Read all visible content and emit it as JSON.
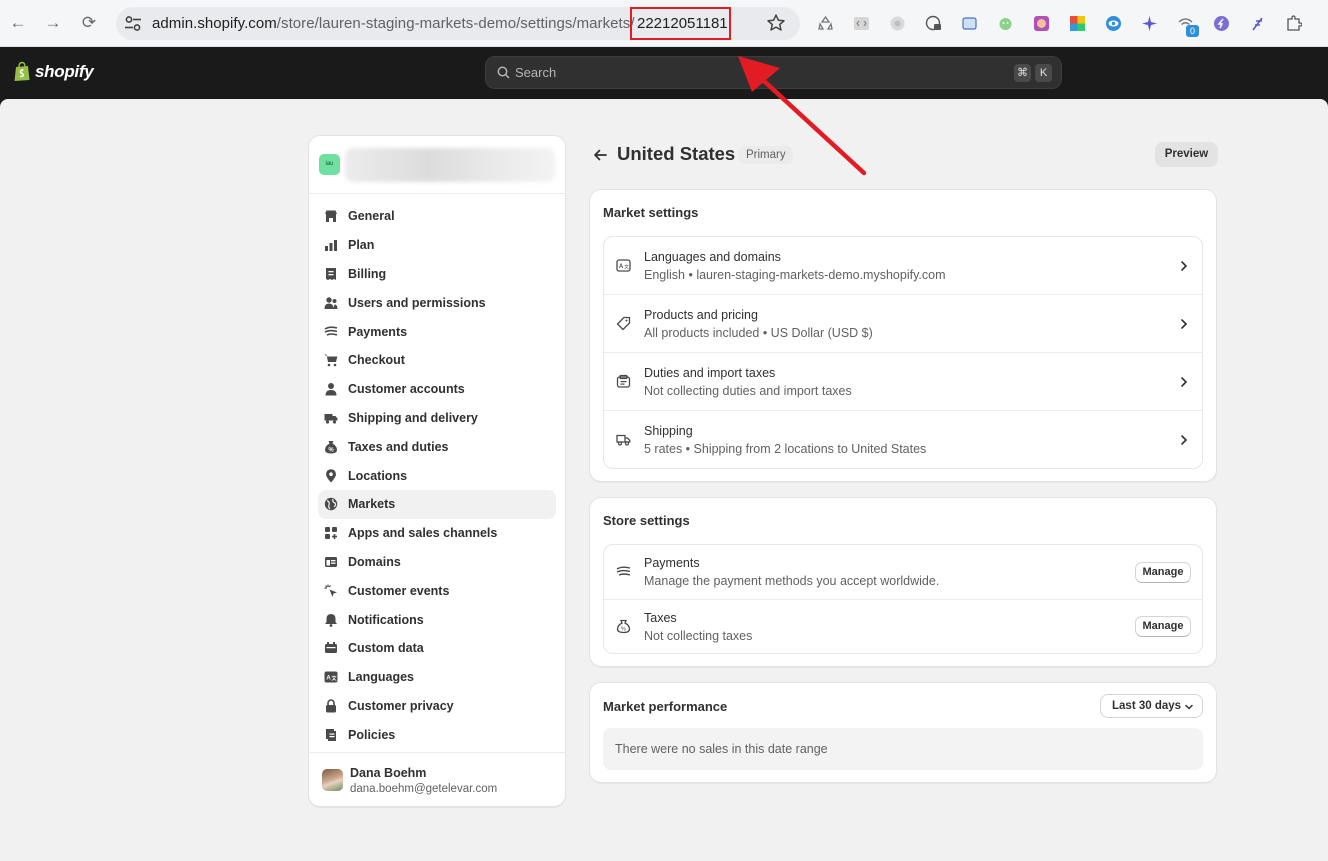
{
  "browser": {
    "url_host": "admin.shopify.com",
    "url_path": "/store/lauren-staging-markets-demo/settings/markets/",
    "url_id": "22212051181",
    "extension_badge": "0"
  },
  "topbar": {
    "logo": "shopify",
    "search_placeholder": "Search",
    "shortcut_keys": [
      "⌘",
      "K"
    ]
  },
  "sidebar": {
    "store_avatar_text": "lau",
    "items": [
      {
        "label": "General",
        "icon": "store-icon"
      },
      {
        "label": "Plan",
        "icon": "chart-icon"
      },
      {
        "label": "Billing",
        "icon": "receipt-icon"
      },
      {
        "label": "Users and permissions",
        "icon": "users-icon"
      },
      {
        "label": "Payments",
        "icon": "payments-icon"
      },
      {
        "label": "Checkout",
        "icon": "cart-icon"
      },
      {
        "label": "Customer accounts",
        "icon": "person-icon"
      },
      {
        "label": "Shipping and delivery",
        "icon": "truck-icon"
      },
      {
        "label": "Taxes and duties",
        "icon": "tax-bag-icon"
      },
      {
        "label": "Locations",
        "icon": "location-pin-icon"
      },
      {
        "label": "Markets",
        "icon": "globe-icon"
      },
      {
        "label": "Apps and sales channels",
        "icon": "apps-icon"
      },
      {
        "label": "Domains",
        "icon": "domain-icon"
      },
      {
        "label": "Customer events",
        "icon": "cursor-sparkle-icon"
      },
      {
        "label": "Notifications",
        "icon": "bell-icon"
      },
      {
        "label": "Custom data",
        "icon": "database-icon"
      },
      {
        "label": "Languages",
        "icon": "translate-icon"
      },
      {
        "label": "Customer privacy",
        "icon": "lock-icon"
      },
      {
        "label": "Policies",
        "icon": "policy-icon"
      }
    ],
    "active_item": "Markets",
    "user": {
      "name": "Dana Boehm",
      "email": "dana.boehm@getelevar.com"
    }
  },
  "page": {
    "title": "United States",
    "badge": "Primary",
    "preview_label": "Preview"
  },
  "market_settings": {
    "title": "Market settings",
    "rows": [
      {
        "title": "Languages and domains",
        "subtitle": "English • lauren-staging-markets-demo.myshopify.com",
        "icon": "translate-icon"
      },
      {
        "title": "Products and pricing",
        "subtitle": "All products included • US Dollar (USD $)",
        "icon": "price-tag-icon"
      },
      {
        "title": "Duties and import taxes",
        "subtitle": "Not collecting duties and import taxes",
        "icon": "duties-icon"
      },
      {
        "title": "Shipping",
        "subtitle": "5 rates • Shipping from 2 locations to United States",
        "icon": "truck-icon"
      }
    ]
  },
  "store_settings": {
    "title": "Store settings",
    "rows": [
      {
        "title": "Payments",
        "subtitle": "Manage the payment methods you accept worldwide.",
        "button": "Manage",
        "icon": "payments-icon"
      },
      {
        "title": "Taxes",
        "subtitle": "Not collecting taxes",
        "button": "Manage",
        "icon": "tax-bag-icon"
      }
    ]
  },
  "market_performance": {
    "title": "Market performance",
    "range_label": "Last 30 days",
    "empty_text": "There were no sales in this date range"
  },
  "colors": {
    "highlight_red": "#e31b23",
    "topbar_bg": "#1a1a1a",
    "page_bg": "#f1f1f1"
  }
}
